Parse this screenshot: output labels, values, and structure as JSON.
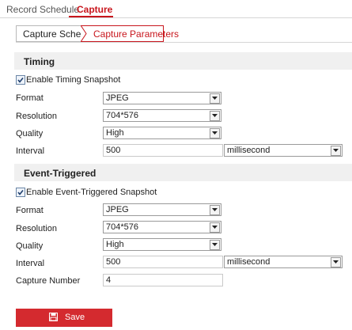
{
  "top_tabs": [
    {
      "label": "Record Schedule",
      "active": false
    },
    {
      "label": "Capture",
      "active": true
    }
  ],
  "sub_tabs": [
    {
      "label": "Capture Schedule",
      "active": false
    },
    {
      "label": "Capture Parameters",
      "active": true
    }
  ],
  "timing": {
    "heading": "Timing",
    "enable_label": "Enable Timing Snapshot",
    "enabled": true,
    "format_label": "Format",
    "format_value": "JPEG",
    "resolution_label": "Resolution",
    "resolution_value": "704*576",
    "quality_label": "Quality",
    "quality_value": "High",
    "interval_label": "Interval",
    "interval_value": "500",
    "interval_unit": "millisecond"
  },
  "event": {
    "heading": "Event-Triggered",
    "enable_label": "Enable Event-Triggered Snapshot",
    "enabled": true,
    "format_label": "Format",
    "format_value": "JPEG",
    "resolution_label": "Resolution",
    "resolution_value": "704*576",
    "quality_label": "Quality",
    "quality_value": "High",
    "interval_label": "Interval",
    "interval_value": "500",
    "interval_unit": "millisecond",
    "capture_number_label": "Capture Number",
    "capture_number_value": "4"
  },
  "save": {
    "label": "Save",
    "icon": "save-disk-icon"
  },
  "colors": {
    "accent": "#c8161d",
    "button": "#d42a2f",
    "section_bg": "#f0f0f0"
  }
}
